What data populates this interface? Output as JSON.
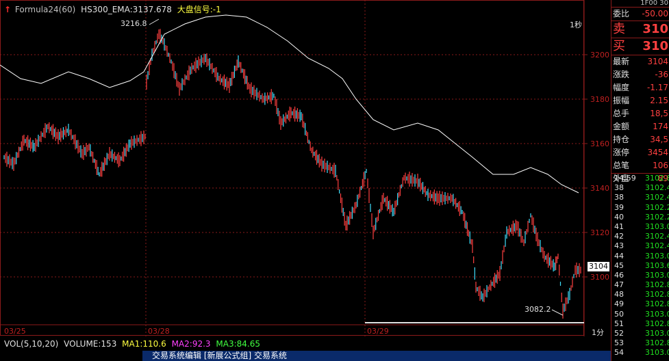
{
  "legend": {
    "formula": "Formula24(60)",
    "ema": "HS300_EMA:3137.678",
    "signal": "大盘信号:-1"
  },
  "chart": {
    "y_ticks": [
      "3200",
      "3180",
      "3160",
      "3140",
      "3120",
      "3100"
    ],
    "high_label": "3216.8",
    "low_label": "3082.2",
    "interval_label": "1秒",
    "current_price": "3104",
    "period": "1分"
  },
  "dates": [
    "03/25",
    "03/28",
    "03/29"
  ],
  "volume": {
    "label": "VOL(5,10,20)",
    "vol": "VOLUME:153",
    "ma1": "MA1:110.6",
    "ma2": "MA2:92.3",
    "ma3": "MA3:84.65"
  },
  "panel": {
    "header": "1F00 30",
    "weibi_label": "委比",
    "weibi_value": "-50.00",
    "sell_label": "卖",
    "sell_value": "310",
    "buy_label": "买",
    "buy_value": "310",
    "stats": [
      {
        "k": "最新",
        "v": "3104"
      },
      {
        "k": "涨跌",
        "v": "-36"
      },
      {
        "k": "幅度",
        "v": "-1.17"
      },
      {
        "k": "振幅",
        "v": "2.15"
      },
      {
        "k": "总手",
        "v": "18,5"
      },
      {
        "k": "金额",
        "v": "174"
      },
      {
        "k": "持仓",
        "v": "34,5"
      },
      {
        "k": "涨停",
        "v": "3454"
      },
      {
        "k": "总笔",
        "v": "106"
      },
      {
        "k": "外盘",
        "v": "89"
      }
    ],
    "ticks": [
      {
        "t": "14:59",
        "p": "3102.8"
      },
      {
        "t": "38",
        "p": "3102.4"
      },
      {
        "t": "38",
        "p": "3102.4"
      },
      {
        "t": "39",
        "p": "3102.2"
      },
      {
        "t": "40",
        "p": "3102.2"
      },
      {
        "t": "41",
        "p": "3103.0"
      },
      {
        "t": "42",
        "p": "3102.4"
      },
      {
        "t": "43",
        "p": "3102.4"
      },
      {
        "t": "44",
        "p": "3103.0"
      },
      {
        "t": "45",
        "p": "3103.6"
      },
      {
        "t": "46",
        "p": "3103.0"
      },
      {
        "t": "47",
        "p": "3102.8"
      },
      {
        "t": "48",
        "p": "3102.8"
      },
      {
        "t": "49",
        "p": "3102.8"
      },
      {
        "t": "50",
        "p": "3103.0"
      },
      {
        "t": "51",
        "p": "3102.8"
      },
      {
        "t": "52",
        "p": "3103.0"
      },
      {
        "t": "53",
        "p": "3102.8"
      },
      {
        "t": "54",
        "p": "3103.0"
      }
    ]
  },
  "taskbar": {
    "text": "交易系统编辑    [新展公式组]    交易系统"
  },
  "colors": {
    "up": "#ff4040",
    "down": "#40e0ff",
    "grid": "#8b1a1a",
    "ema": "#ffffff"
  }
}
